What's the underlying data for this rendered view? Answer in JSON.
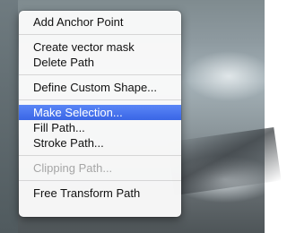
{
  "menu": {
    "groups": [
      [
        "Add Anchor Point"
      ],
      [
        "Create vector mask",
        "Delete Path"
      ],
      [
        "Define Custom Shape..."
      ],
      [
        "Make Selection...",
        "Fill Path...",
        "Stroke Path..."
      ],
      [
        "Clipping Path..."
      ],
      [
        "Free Transform Path"
      ]
    ],
    "selected_item": "Make Selection...",
    "disabled_items": [
      "Clipping Path..."
    ]
  },
  "colors": {
    "highlight": "#3a66e6",
    "menu_background": "#fafafa",
    "disabled_text": "#a6a6a6"
  }
}
